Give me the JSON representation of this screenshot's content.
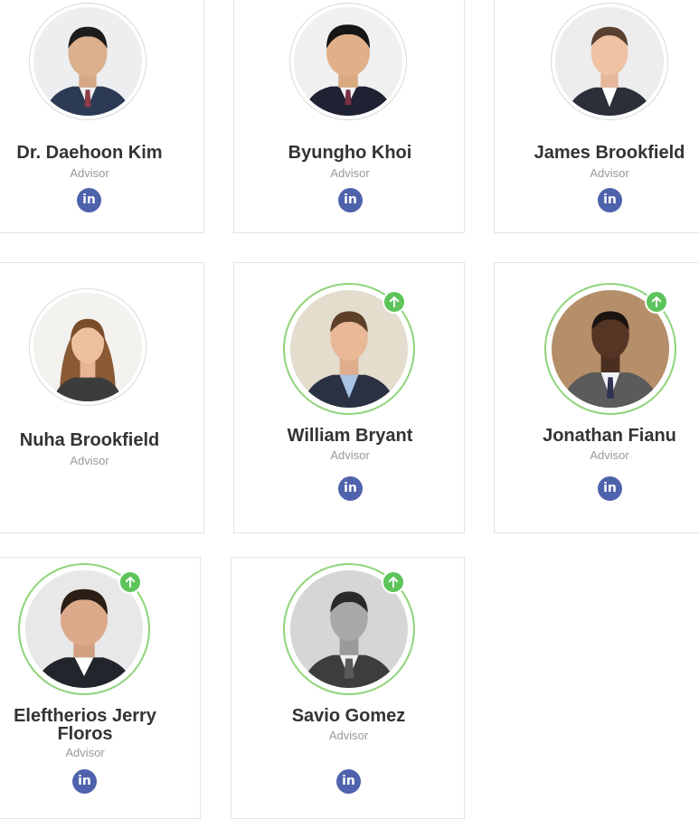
{
  "advisors": [
    {
      "name": "Dr. Daehoon Kim",
      "role": "Advisor",
      "linkedin_icon": "in",
      "verified": false
    },
    {
      "name": "Byungho Khoi",
      "role": "Advisor",
      "linkedin_icon": "in",
      "verified": false
    },
    {
      "name": "James Brookfield",
      "role": "Advisor",
      "linkedin_icon": "in",
      "verified": false
    },
    {
      "name": "Nuha Brookfield",
      "role": "Advisor",
      "verified": false
    },
    {
      "name": "William Bryant",
      "role": "Advisor",
      "linkedin_icon": "in",
      "verified": true
    },
    {
      "name": "Jonathan Fianu",
      "role": "Advisor",
      "linkedin_icon": "in",
      "verified": true
    },
    {
      "name_line1": "Eleftherios Jerry",
      "name_line2": "Floros",
      "role": "Advisor",
      "linkedin_icon": "in",
      "verified": true
    },
    {
      "name": "Savio Gomez",
      "role": "Advisor",
      "linkedin_icon": "in",
      "verified": true
    }
  ],
  "colors": {
    "linkedin": "#4f62ac",
    "verified_badge": "#5cc45a",
    "verified_ring": "#8fd47a",
    "name": "#333333",
    "role": "#999999"
  },
  "icons": {
    "social": "linkedin-icon",
    "badge": "up-arrow-icon",
    "photo": "person-photo"
  }
}
